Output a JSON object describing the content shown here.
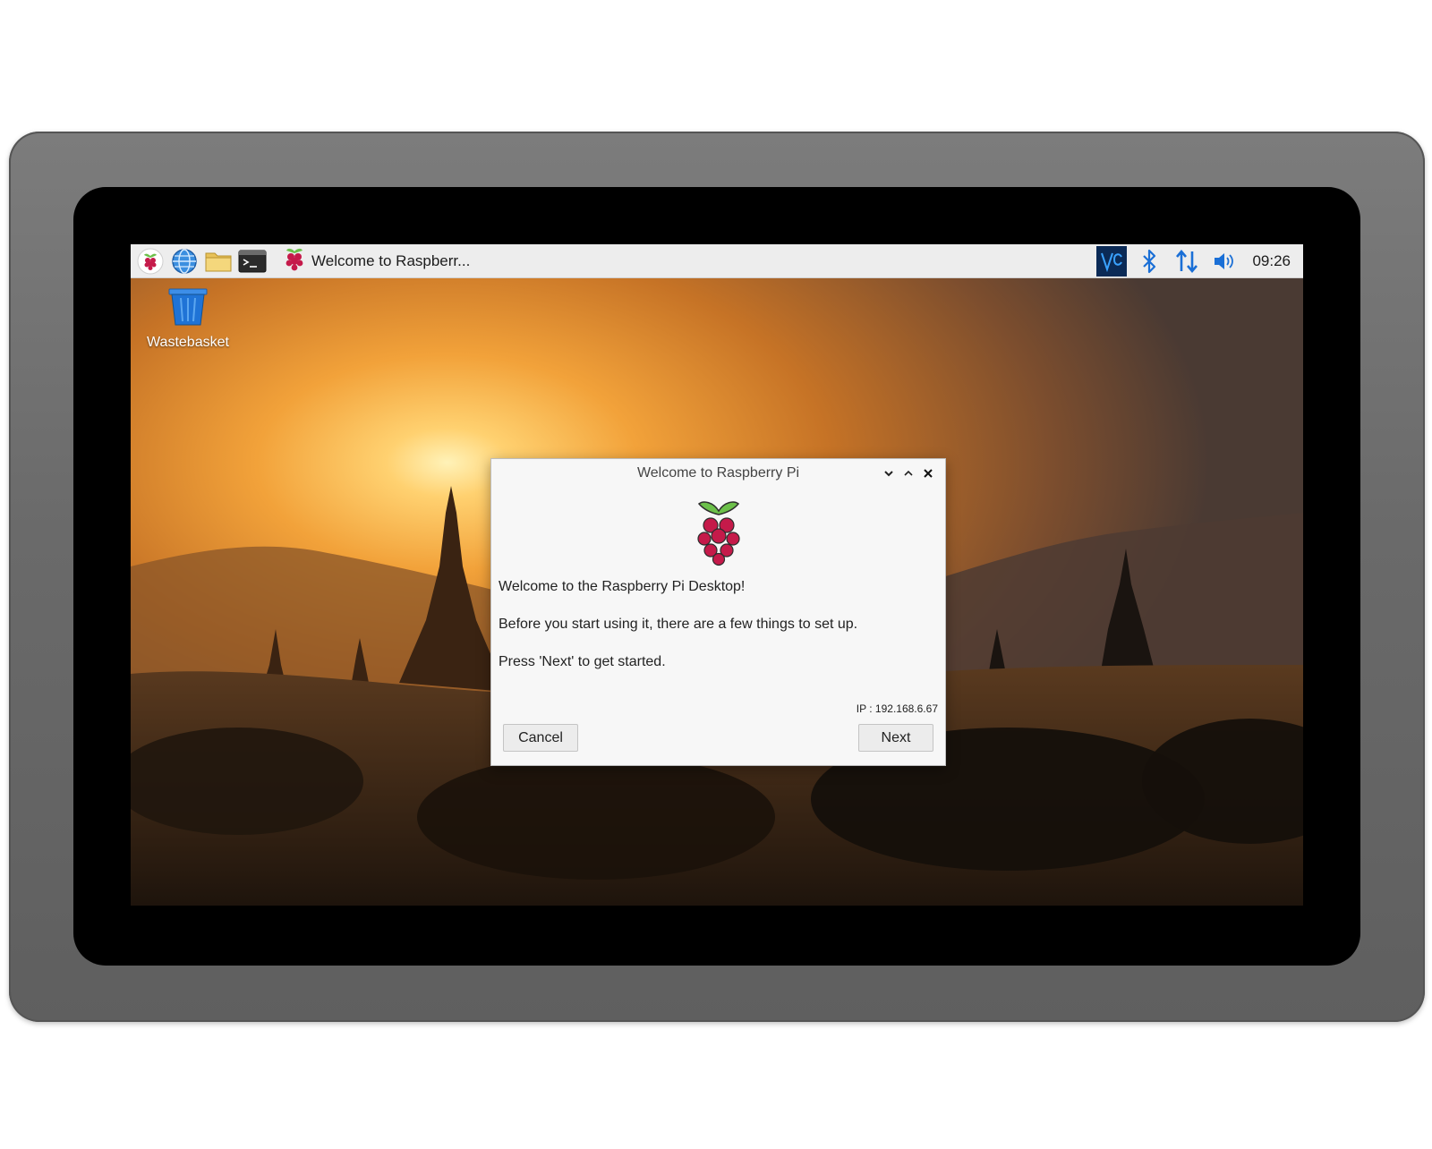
{
  "taskbar": {
    "launchers": [
      {
        "icon": "raspberry-menu-icon"
      },
      {
        "icon": "web-browser-icon"
      },
      {
        "icon": "file-manager-icon"
      },
      {
        "icon": "terminal-icon"
      }
    ],
    "task": {
      "label": "Welcome to Raspberr...",
      "icon": "raspberry-icon"
    },
    "tray": {
      "icons": [
        "vnc-icon",
        "bluetooth-icon",
        "network-icon",
        "volume-icon"
      ],
      "clock": "09:26"
    }
  },
  "desktop": {
    "icons": [
      {
        "label": "Wastebasket",
        "icon": "wastebasket-icon"
      }
    ]
  },
  "dialog": {
    "title": "Welcome to Raspberry Pi",
    "message_1": "Welcome to the Raspberry Pi Desktop!",
    "message_2": "Before you start using it, there are a few things to set up.",
    "message_3": "Press 'Next' to get started.",
    "ip": "IP : 192.168.6.67",
    "cancel_label": "Cancel",
    "next_label": "Next"
  },
  "colors": {
    "accent_blue": "#1a6fd6",
    "raspberry_red": "#c51a4a",
    "leaf_green": "#6cc04a",
    "vnc_bg": "#0b2a56"
  }
}
